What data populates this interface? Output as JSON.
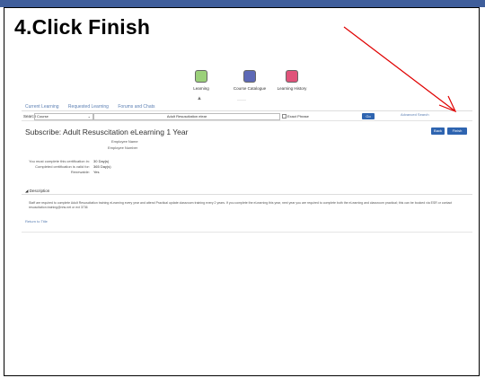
{
  "slide": {
    "title": "4.Click Finish"
  },
  "nav": {
    "items": [
      {
        "label": "Learning",
        "color": "#9bd07a"
      },
      {
        "label": "Course Catalogue",
        "color": "#5d69b6"
      },
      {
        "label": "Learning History",
        "color": "#e0537a"
      }
    ]
  },
  "tabs": [
    "Current Learning",
    "Requested Learning",
    "Forums and Chats"
  ],
  "search": {
    "label": "Search",
    "category": "Course",
    "query": "Adult Resuscitation elear",
    "exact_label": "Exact Phrase",
    "go_label": "Go",
    "advanced_label": "Advanced Search"
  },
  "course": {
    "title": "Subscribe: Adult Resuscitation eLearning 1 Year",
    "back_label": "Back",
    "finish_label": "Finish",
    "employee_name_label": "Employee Name",
    "employee_number_label": "Employee Number",
    "rows": [
      {
        "label": "You must complete this certification in:",
        "value": "30",
        "unit": "Day(s)"
      },
      {
        "label": "Completed certification is valid for:",
        "value": "365",
        "unit": "Day(s)"
      },
      {
        "label": "Renewable:",
        "value": "Yes",
        "unit": ""
      }
    ],
    "description_heading": "Description",
    "description_text": "Staff are required to complete Adult Resuscitation training eLearning every year and attend Practical update classroom training every 2 years. If you complete the eLearning this year, next year you are required to complete both the eLearning and classroom practical; this can be booked via ESR or contact resuscitation.training@nhs.net or ext 3736",
    "return_label": "Return to Title"
  }
}
